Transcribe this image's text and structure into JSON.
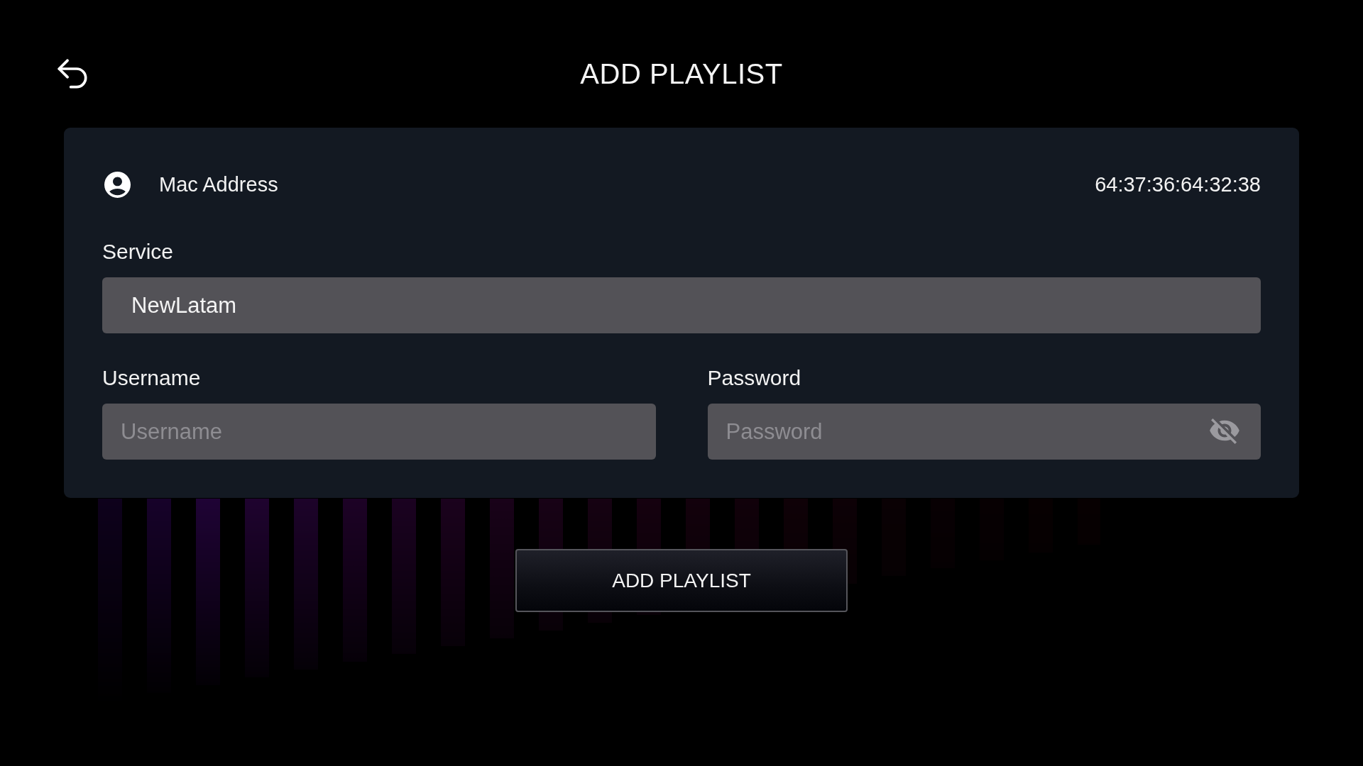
{
  "header": {
    "title": "ADD PLAYLIST"
  },
  "mac": {
    "label": "Mac Address",
    "value": "64:37:36:64:32:38"
  },
  "service": {
    "label": "Service",
    "value": "NewLatam"
  },
  "username": {
    "label": "Username",
    "placeholder": "Username"
  },
  "password": {
    "label": "Password",
    "placeholder": "Password",
    "visible": false
  },
  "button": {
    "label": "ADD PLAYLIST"
  }
}
